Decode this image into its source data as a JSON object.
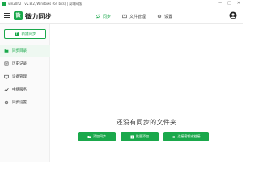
{
  "titlebar": {
    "title": "vm20h2 | v2.8.2, Windows (64 bits) | 局域网版",
    "controls": [
      "—",
      "□",
      "✕"
    ]
  },
  "header": {
    "logo_mark": "微",
    "logo_text": "微力同步",
    "nav": [
      {
        "label": "同步",
        "icon": "sync-icon",
        "active": true
      },
      {
        "label": "文件管理",
        "icon": "folder-icon",
        "active": false
      },
      {
        "label": "设置",
        "icon": "gear-icon",
        "active": false
      }
    ],
    "avatar_icon": "user-icon"
  },
  "sidebar": {
    "new_button": "新建同步",
    "items": [
      {
        "label": "同步目录",
        "icon": "folder-icon",
        "active": true
      },
      {
        "label": "历史记录",
        "icon": "history-icon",
        "active": false
      },
      {
        "label": "设备管理",
        "icon": "device-icon",
        "active": false
      },
      {
        "label": "中继服务",
        "icon": "relay-icon",
        "active": false
      },
      {
        "label": "同步设置",
        "icon": "gear-icon",
        "active": false
      }
    ]
  },
  "main": {
    "empty_text": "还没有同步的文件夹",
    "buttons": [
      {
        "label": "添加同步",
        "icon": "folder-add-icon"
      },
      {
        "label": "批量添加",
        "icon": "batch-add-icon"
      },
      {
        "label": "连接密钥或链接",
        "icon": "key-icon"
      }
    ]
  },
  "colors": {
    "accent": "#1aa84b"
  }
}
